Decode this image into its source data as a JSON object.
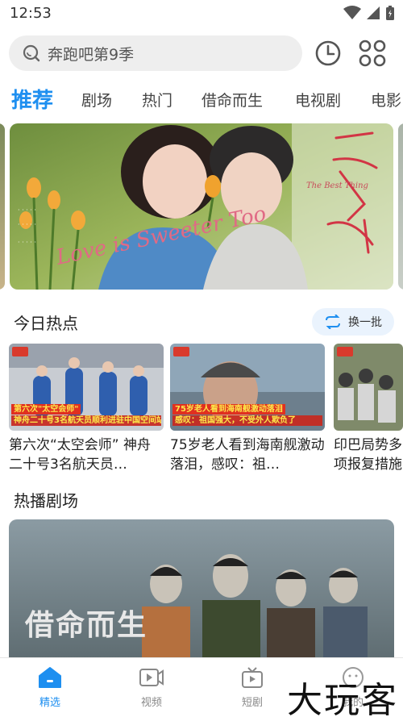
{
  "status_bar": {
    "time": "12:53",
    "icons": [
      "wifi-icon",
      "signal-icon",
      "battery-icon"
    ]
  },
  "search": {
    "placeholder": "奔跑吧第9季"
  },
  "header_icons": [
    "history-icon",
    "apps-grid-icon"
  ],
  "tabs": [
    {
      "label": "推荐",
      "active": true
    },
    {
      "label": "剧场"
    },
    {
      "label": "热门"
    },
    {
      "label": "借命而生"
    },
    {
      "label": "电视剧"
    },
    {
      "label": "电影"
    }
  ],
  "banner": {
    "title_art": "一爱你",
    "script_art": "Love is Sweeter Too",
    "subtitle_art": "The Best Thing"
  },
  "today_hot": {
    "title": "今日热点",
    "refresh_label": "换一批",
    "items": [
      {
        "caption_top": "第六次\"太空会师\"",
        "caption_bottom": "神舟二十号3名航天员顺利进驻中国空间站",
        "title": "第六次“太空会师” 神舟二十号3名航天员…"
      },
      {
        "caption_top": "75岁老人看到海南舰激动落泪",
        "caption_bottom": "感叹：祖国强大，不受外人欺负了",
        "title": "75岁老人看到海南舰激动落泪，感叹：祖…"
      },
      {
        "caption_top": "",
        "caption_bottom": "",
        "title": "印巴局势多项报复措施"
      }
    ]
  },
  "hot_drama": {
    "title": "热播剧场",
    "poster_title": "借命而生"
  },
  "bottom_nav": [
    {
      "label": "精选",
      "active": true
    },
    {
      "label": "视频"
    },
    {
      "label": "短剧"
    },
    {
      "label": "我的"
    }
  ],
  "watermark": "大玩客",
  "colors": {
    "accent": "#1e8ff0",
    "caption_red": "#e03020",
    "caption_yellow": "#fde84a"
  }
}
